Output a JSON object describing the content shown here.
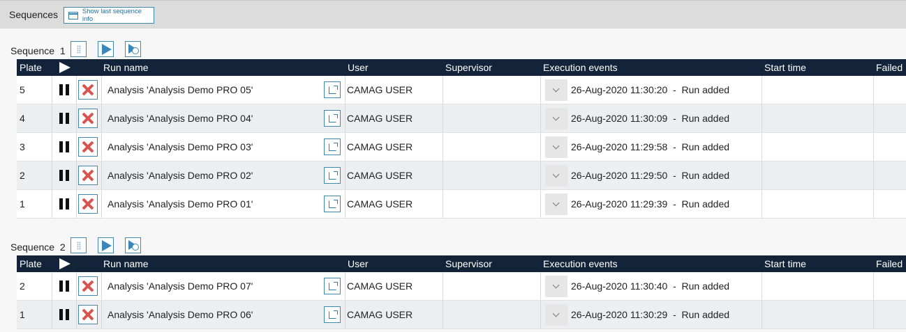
{
  "header": {
    "title": "Sequences",
    "show_last_label": "Show last sequence info"
  },
  "columns": {
    "plate": "Plate",
    "run_name": "Run name",
    "user": "User",
    "supervisor": "Supervisor",
    "execution_events": "Execution events",
    "start_time": "Start time",
    "failed": "Failed"
  },
  "sequences": [
    {
      "label": "Sequence",
      "number": "1",
      "rows": [
        {
          "plate": "5",
          "run_name": "Analysis 'Analysis Demo PRO 05'",
          "user": "CAMAG USER",
          "supervisor": "",
          "event": "26-Aug-2020 11:30:20  -  Run added",
          "start_time": "",
          "failed": ""
        },
        {
          "plate": "4",
          "run_name": "Analysis 'Analysis Demo PRO 04'",
          "user": "CAMAG USER",
          "supervisor": "",
          "event": "26-Aug-2020 11:30:09  -  Run added",
          "start_time": "",
          "failed": ""
        },
        {
          "plate": "3",
          "run_name": "Analysis 'Analysis Demo PRO 03'",
          "user": "CAMAG USER",
          "supervisor": "",
          "event": "26-Aug-2020 11:29:58  -  Run added",
          "start_time": "",
          "failed": ""
        },
        {
          "plate": "2",
          "run_name": "Analysis 'Analysis Demo PRO 02'",
          "user": "CAMAG USER",
          "supervisor": "",
          "event": "26-Aug-2020 11:29:50  -  Run added",
          "start_time": "",
          "failed": ""
        },
        {
          "plate": "1",
          "run_name": "Analysis 'Analysis Demo PRO 01'",
          "user": "CAMAG USER",
          "supervisor": "",
          "event": "26-Aug-2020 11:29:39  -  Run added",
          "start_time": "",
          "failed": ""
        }
      ]
    },
    {
      "label": "Sequence",
      "number": "2",
      "rows": [
        {
          "plate": "2",
          "run_name": "Analysis 'Analysis Demo PRO 07'",
          "user": "CAMAG USER",
          "supervisor": "",
          "event": "26-Aug-2020 11:30:40  -  Run added",
          "start_time": "",
          "failed": ""
        },
        {
          "plate": "1",
          "run_name": "Analysis 'Analysis Demo PRO 06'",
          "user": "CAMAG USER",
          "supervisor": "",
          "event": "26-Aug-2020 11:30:29  -  Run added",
          "start_time": "",
          "failed": ""
        }
      ]
    }
  ]
}
